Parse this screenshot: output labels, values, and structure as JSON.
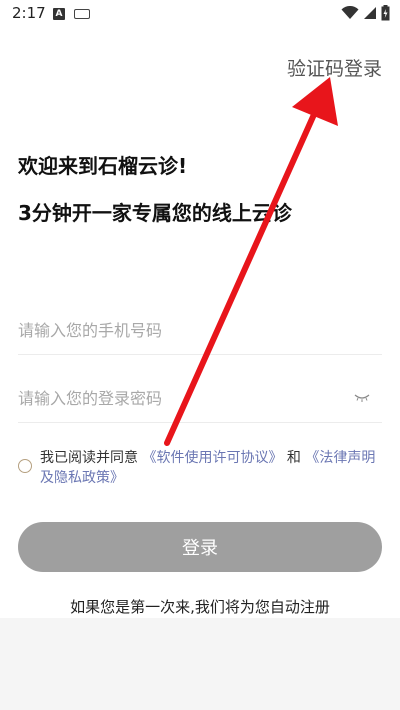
{
  "status_bar": {
    "time": "2:17",
    "notif_letter": "A"
  },
  "header": {
    "sms_login_link": "验证码登录"
  },
  "welcome": {
    "line1": "欢迎来到石榴云诊!",
    "line2": "3分钟开一家专属您的线上云诊"
  },
  "form": {
    "phone_placeholder": "请输入您的手机号码",
    "password_placeholder": "请输入您的登录密码"
  },
  "agreement": {
    "prefix": "我已阅读并同意",
    "license_link": "《软件使用许可协议》",
    "and": "和",
    "privacy_link": "《法律声明及隐私政策》"
  },
  "login_button": "登录",
  "footer_note": "如果您是第一次来,我们将为您自动注册",
  "colors": {
    "accent_link": "#6b77b3",
    "button_disabled": "#9f9f9f",
    "annotation_arrow": "#e8151b"
  }
}
